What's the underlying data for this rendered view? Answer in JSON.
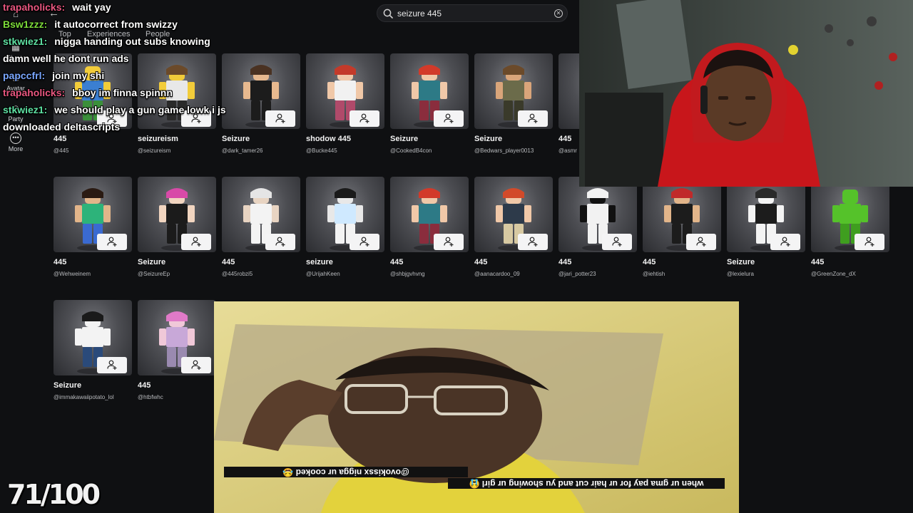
{
  "search": {
    "value": "seizure 445"
  },
  "tabs": [
    "Top",
    "Experiences",
    "People"
  ],
  "rail": [
    {
      "label": "Charts",
      "icon": "chart-icon"
    },
    {
      "label": "Avatar",
      "icon": "avatar-icon"
    },
    {
      "label": "Party",
      "icon": "party-icon"
    },
    {
      "label": "More",
      "icon": "more-icon"
    }
  ],
  "results": [
    {
      "name": "445",
      "handle": "@445",
      "skin": "#f2cc3a",
      "shirt": "#3b7fd1",
      "pants": "#3b8f3a",
      "hair": "none"
    },
    {
      "name": "seizureism",
      "handle": "@seizureism",
      "skin": "#f2cc3a",
      "shirt": "#e8e8e8",
      "pants": "#2a2a2a",
      "hair": "#6b4a2a"
    },
    {
      "name": "Seizure",
      "handle": "@dark_tamer26",
      "skin": "#e7b98f",
      "shirt": "#1c1c1c",
      "pants": "#1c1c1c",
      "hair": "#4a3222"
    },
    {
      "name": "shodow 445",
      "handle": "@Bucke445",
      "skin": "#f0c8a8",
      "shirt": "#f1f1f1",
      "pants": "#b04a6a",
      "hair": "#c33a2a"
    },
    {
      "name": "Seizure",
      "handle": "@CookedB4con",
      "skin": "#f0c8a8",
      "shirt": "#2d7a86",
      "pants": "#8a2d3d",
      "hair": "#d23a2a"
    },
    {
      "name": "Seizure",
      "handle": "@Bedwars_player0013",
      "skin": "#d9a57a",
      "shirt": "#6b6b4a",
      "pants": "#3a3a2a",
      "hair": "#6b4a2a"
    },
    {
      "name": "445",
      "handle": "@asmr",
      "skin": "#c8c8c8",
      "shirt": "#555555",
      "pants": "#333333",
      "hair": "none"
    },
    {
      "name": "445",
      "handle": "@Wehweinem",
      "skin": "#e2b58a",
      "shirt": "#2db37a",
      "pants": "#3a6ad1",
      "hair": "#2a1a12"
    },
    {
      "name": "Seizure",
      "handle": "@SeizureEp",
      "skin": "#f1d5c0",
      "shirt": "#1b1b1b",
      "pants": "#1b1b1b",
      "hair": "#d84aa8"
    },
    {
      "name": "445",
      "handle": "@445robzi5",
      "skin": "#e8d4c2",
      "shirt": "#f3f3f3",
      "pants": "#f3f3f3",
      "hair": "#e5e5e5"
    },
    {
      "name": "seizure",
      "handle": "@UrijahKeen",
      "skin": "#e8e8e8",
      "shirt": "#cfe9ff",
      "pants": "#f3f3f3",
      "hair": "#1a1a1a"
    },
    {
      "name": "445",
      "handle": "@shbjgvhvng",
      "skin": "#f0c8a8",
      "shirt": "#2d7a86",
      "pants": "#8a2d3d",
      "hair": "#d23a2a"
    },
    {
      "name": "445",
      "handle": "@aanacardoo_09",
      "skin": "#f0c8a8",
      "shirt": "#2d3a4a",
      "pants": "#d7c9a2",
      "hair": "#d24a2a"
    },
    {
      "name": "445",
      "handle": "@jari_potter23",
      "skin": "#111111",
      "shirt": "#f2f2f2",
      "pants": "#f2f2f2",
      "hair": "#f2f2f2"
    },
    {
      "name": "445",
      "handle": "@iehtish",
      "skin": "#e2b58a",
      "shirt": "#1c1c1c",
      "pants": "#1c1c1c",
      "hair": "#c02a2a"
    },
    {
      "name": "Seizure",
      "handle": "@lexielura",
      "skin": "#f3f3f3",
      "shirt": "#1c1c1c",
      "pants": "#f3f3f3",
      "hair": "#2a2a2a"
    },
    {
      "name": "445",
      "handle": "@GreenZone_dX",
      "skin": "#55c22a",
      "shirt": "#55c22a",
      "pants": "#3f9e1f",
      "hair": "none"
    },
    {
      "name": "Seizure",
      "handle": "@immakawaiipotato_lol",
      "skin": "#f3f3f3",
      "shirt": "#f3f3f3",
      "pants": "#2a4a7a",
      "hair": "#1a1a1a"
    },
    {
      "name": "445",
      "handle": "@htbfwhc",
      "skin": "#f0c8d8",
      "shirt": "#c8a8d8",
      "pants": "#9a8ab0",
      "hair": "#e07ac8"
    }
  ],
  "chat": [
    {
      "user": "trapaholicks:",
      "msg": "wait yay",
      "color": "#e8567f"
    },
    {
      "user": "Bsw1zzz:",
      "msg": "it autocorrect from swizzy",
      "color": "#7ddc3a"
    },
    {
      "user": "stkwiez1:",
      "msg": "nigga handing out subs knowing",
      "color": "#5ee0a2"
    },
    {
      "user": "",
      "msg": "damn well he dont run ads",
      "color": "#ffffff"
    },
    {
      "user": "papccfrl:",
      "msg": "join my shi",
      "color": "#7aa7ff"
    },
    {
      "user": "trapaholicks:",
      "msg": "bboy im finna spinnn",
      "color": "#e8567f"
    },
    {
      "user": "stkwiez1:",
      "msg": "we should play a gun game lowk i js",
      "color": "#5ee0a2"
    },
    {
      "user": "",
      "msg": "downloaded deltascripts",
      "color": "#ffffff"
    }
  ],
  "video_captions": [
    {
      "text": "@ovokissx  nigga ur cooked 😂"
    },
    {
      "text": "when ur gma pay for ur hair cut and yu showing ur girl 😭"
    }
  ],
  "score": "71/100"
}
